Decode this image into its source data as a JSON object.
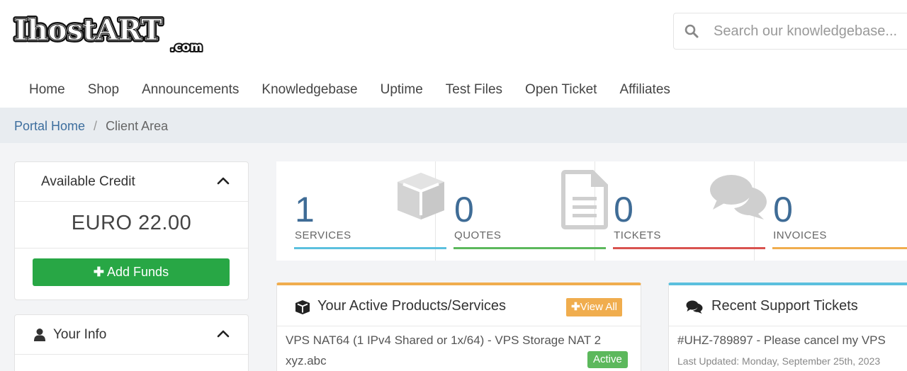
{
  "header": {
    "logo_text": "IHOSTART.com",
    "search": {
      "placeholder": "Search our knowledgebase..."
    }
  },
  "nav": {
    "items": [
      {
        "label": "Home"
      },
      {
        "label": "Shop"
      },
      {
        "label": "Announcements"
      },
      {
        "label": "Knowledgebase"
      },
      {
        "label": "Uptime"
      },
      {
        "label": "Test Files"
      },
      {
        "label": "Open Ticket"
      },
      {
        "label": "Affiliates"
      }
    ]
  },
  "breadcrumb": {
    "home": "Portal Home",
    "separator": "/",
    "current": "Client Area"
  },
  "sidebar": {
    "credit": {
      "title": "Available Credit",
      "amount": "EURO 22.00",
      "button": "Add Funds"
    },
    "info": {
      "title": "Your Info"
    }
  },
  "stats": [
    {
      "value": "1",
      "label": "SERVICES",
      "color": "#5bc0de"
    },
    {
      "value": "0",
      "label": "QUOTES",
      "color": "#5cb85c"
    },
    {
      "value": "0",
      "label": "TICKETS",
      "color": "#d9534f"
    },
    {
      "value": "0",
      "label": "INVOICES",
      "color": "#f0ad4e"
    }
  ],
  "products": {
    "title": "Your Active Products/Services",
    "view_all": "View All",
    "accent": "#f0ad4e",
    "item": {
      "name": "VPS NAT64 (1 IPv4 Shared or 1x/64) - VPS Storage NAT 2",
      "domain": "xyz.abc",
      "status": "Active"
    }
  },
  "tickets": {
    "title": "Recent Support Tickets",
    "accent": "#5bc0de",
    "item": {
      "subject": "#UHZ-789897 - Please cancel my VPS",
      "updated": "Last Updated: Monday, September 25th, 2023"
    }
  }
}
